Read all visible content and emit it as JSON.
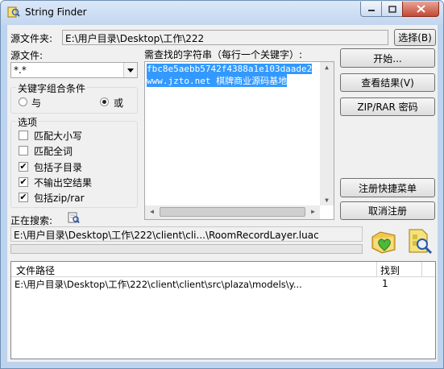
{
  "window": {
    "title": "String Finder"
  },
  "source_folder": {
    "label": "源文件夹:",
    "value": "E:\\用户目录\\Desktop\\工作\\222",
    "browse_label": "选择(B)"
  },
  "source_files": {
    "label": "源文件:",
    "value": "*.*"
  },
  "search_strings": {
    "label": "需查找的字符串（每行一个关键字）:",
    "lines": [
      "fbc8e5aebb5742f4388a1e103daade2",
      "www.jzto.net 棋牌商业源码基地"
    ]
  },
  "keyword_logic": {
    "title": "关键字组合条件",
    "and_label": "与",
    "or_label": "或",
    "selected": "or"
  },
  "options": {
    "title": "选项",
    "items": [
      {
        "label": "匹配大小写",
        "checked": false
      },
      {
        "label": "匹配全词",
        "checked": false
      },
      {
        "label": "包括子目录",
        "checked": true
      },
      {
        "label": "不输出空结果",
        "checked": true
      },
      {
        "label": "包括zip/rar",
        "checked": true
      }
    ]
  },
  "buttons": {
    "start": "开始...",
    "view_results": "查看结果(V)",
    "zip_password": "ZIP/RAR 密码",
    "register_menu": "注册快捷菜单",
    "unregister": "取消注册"
  },
  "searching": {
    "label": "正在搜索:",
    "current_path": "E:\\用户目录\\Desktop\\工作\\222\\client\\cli...\\RoomRecordLayer.luac"
  },
  "results": {
    "columns": [
      "文件路径",
      "找到"
    ],
    "rows": [
      {
        "path": "E:\\用户目录\\Desktop\\工作\\222\\client\\client\\src\\plaza\\models\\y...",
        "count": "1"
      }
    ]
  },
  "check_mark": "✔"
}
